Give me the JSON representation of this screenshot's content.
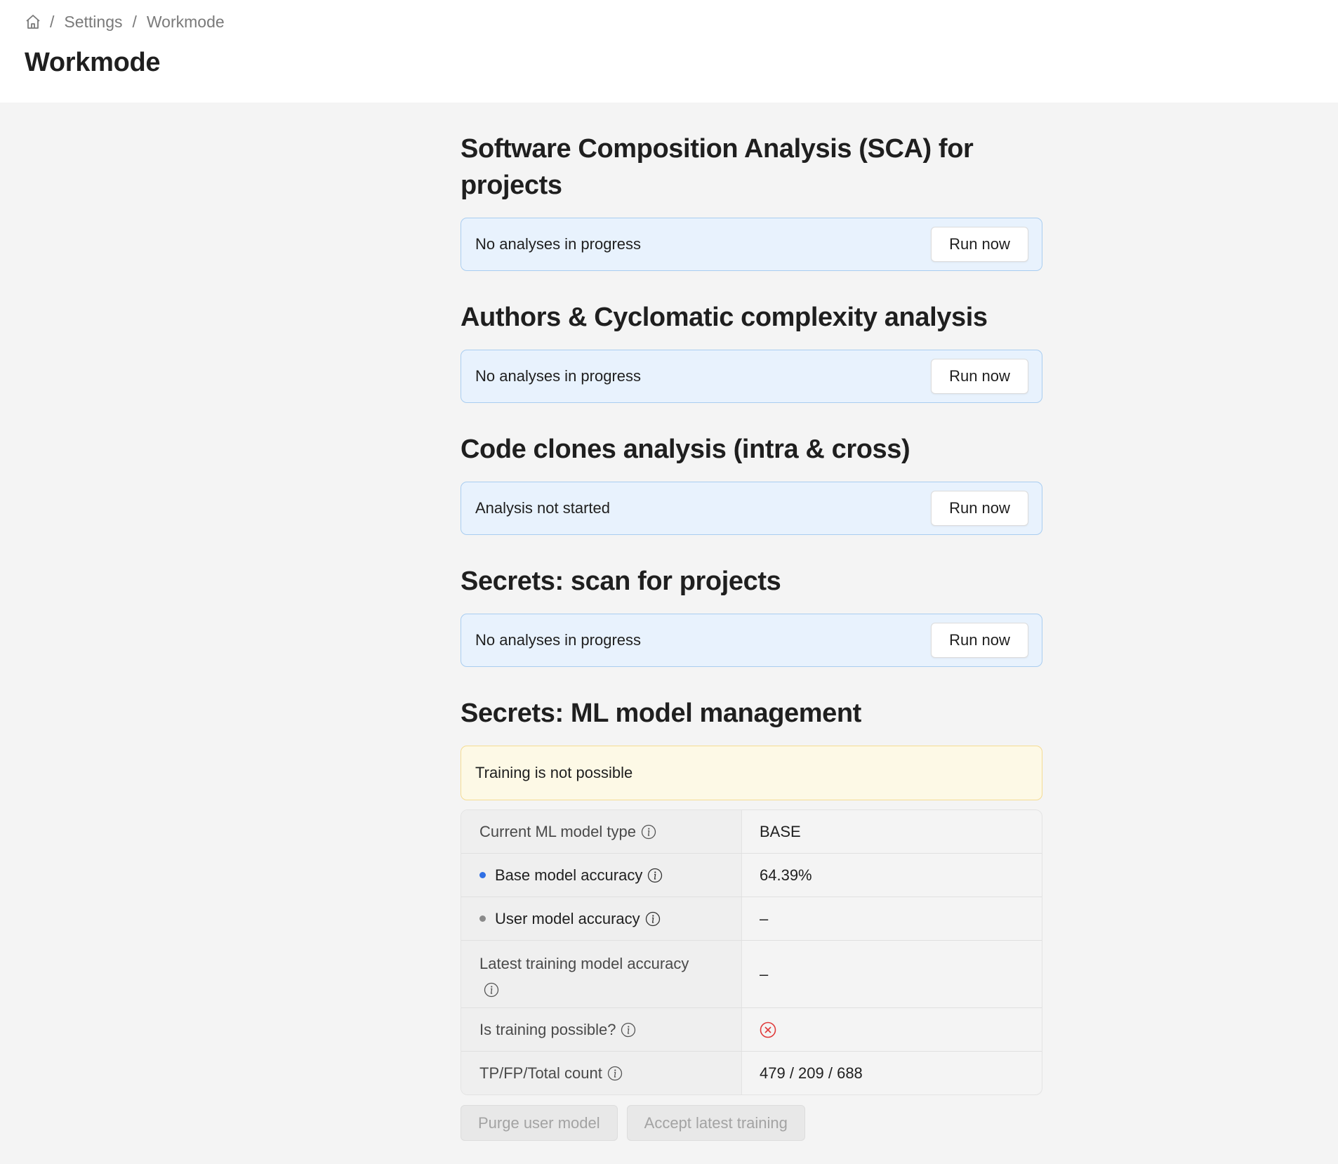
{
  "breadcrumb": {
    "home_icon": "home-icon",
    "separator": "/",
    "items": [
      "Settings",
      "Workmode"
    ]
  },
  "page_title": "Workmode",
  "sections": [
    {
      "title": "Software Composition Analysis (SCA) for projects",
      "status": "No analyses in progress",
      "button": "Run now"
    },
    {
      "title": "Authors & Cyclomatic complexity analysis",
      "status": "No analyses in progress",
      "button": "Run now"
    },
    {
      "title": "Code clones analysis (intra & cross)",
      "status": "Analysis not started",
      "button": "Run now"
    },
    {
      "title": "Secrets: scan for projects",
      "status": "No analyses in progress",
      "button": "Run now"
    }
  ],
  "ml": {
    "title": "Secrets: ML model management",
    "warning": "Training is not possible",
    "rows": [
      {
        "label": "Current ML model type",
        "value": "BASE"
      },
      {
        "label": "Base model accuracy",
        "value": "64.39%",
        "dot_color": "#2f6fe4"
      },
      {
        "label": "User model accuracy",
        "value": "–",
        "dot_color": "#8a8a8a"
      },
      {
        "label": "Latest training model accuracy",
        "value": "–"
      },
      {
        "label": "Is training possible?",
        "value_icon": "x-circle-icon",
        "value_color": "#e03a3a"
      },
      {
        "label": "TP/FP/Total count",
        "value": "479 / 209 / 688"
      }
    ],
    "buttons": {
      "purge": "Purge user model",
      "accept": "Accept latest training"
    }
  }
}
